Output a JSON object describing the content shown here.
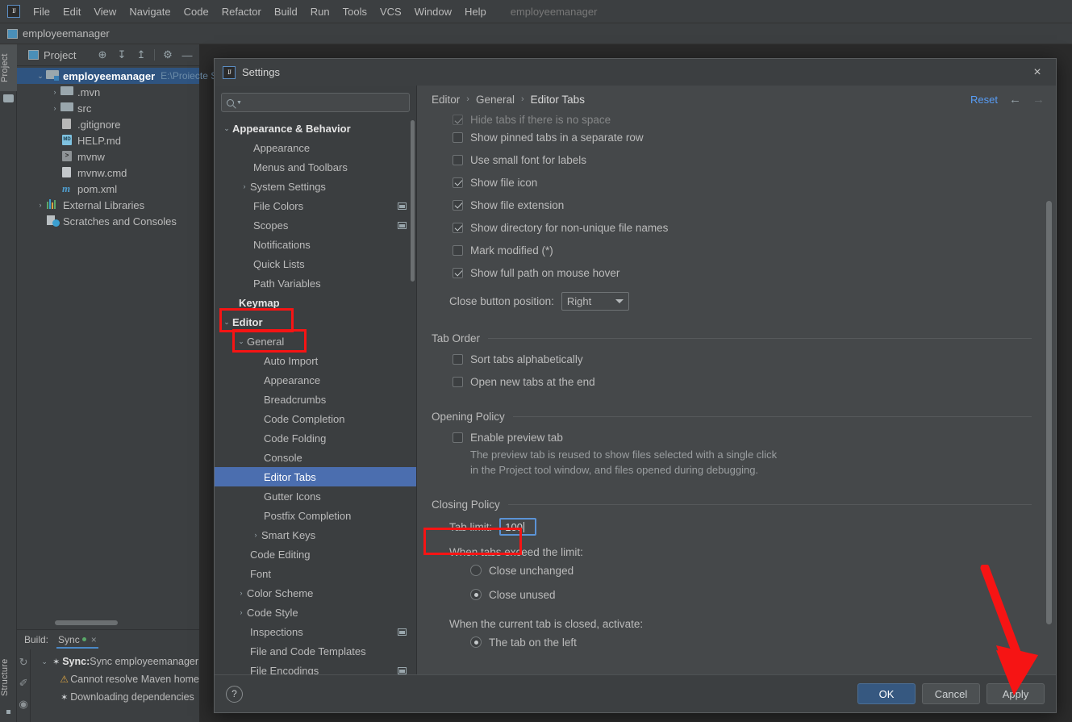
{
  "app": {
    "logo_text": "IJ",
    "project_name": "employeemanager",
    "menu": [
      "File",
      "Edit",
      "View",
      "Navigate",
      "Code",
      "Refactor",
      "Build",
      "Run",
      "Tools",
      "VCS",
      "Window",
      "Help"
    ],
    "navbar_item": "employeemanager"
  },
  "left_strip": {
    "project_tab": "Project",
    "structure_tab": "Structure"
  },
  "project_panel": {
    "title": "Project",
    "tools": [
      {
        "name": "locate-icon",
        "glyph": "⊕"
      },
      {
        "name": "expand-all-icon",
        "glyph": "↧"
      },
      {
        "name": "collapse-all-icon",
        "glyph": "↥"
      },
      {
        "name": "settings-gear-icon",
        "glyph": "⚙"
      },
      {
        "name": "hide-icon",
        "glyph": "—"
      }
    ],
    "tree": [
      {
        "label": "employeemanager",
        "path": "E:\\Proiecte SS",
        "arrow": "⌄",
        "indent": 0,
        "icon": "module-folder",
        "bold": true,
        "selected": true
      },
      {
        "label": ".mvn",
        "path": "",
        "arrow": "›",
        "indent": 1,
        "icon": "folder",
        "bold": false,
        "selected": false
      },
      {
        "label": "src",
        "path": "",
        "arrow": "›",
        "indent": 1,
        "icon": "folder",
        "bold": false,
        "selected": false
      },
      {
        "label": ".gitignore",
        "path": "",
        "arrow": "",
        "indent": 1,
        "icon": "git",
        "bold": false,
        "selected": false
      },
      {
        "label": "HELP.md",
        "path": "",
        "arrow": "",
        "indent": 1,
        "icon": "md",
        "bold": false,
        "selected": false
      },
      {
        "label": "mvnw",
        "path": "",
        "arrow": "",
        "indent": 1,
        "icon": "shell",
        "bold": false,
        "selected": false
      },
      {
        "label": "mvnw.cmd",
        "path": "",
        "arrow": "",
        "indent": 1,
        "icon": "file",
        "bold": false,
        "selected": false
      },
      {
        "label": "pom.xml",
        "path": "",
        "arrow": "",
        "indent": 1,
        "icon": "maven",
        "bold": false,
        "selected": false
      },
      {
        "label": "External Libraries",
        "path": "",
        "arrow": "›",
        "indent": 0,
        "icon": "library",
        "bold": false,
        "selected": false
      },
      {
        "label": "Scratches and Consoles",
        "path": "",
        "arrow": "",
        "indent": 0,
        "icon": "scratch",
        "bold": false,
        "selected": false
      }
    ]
  },
  "build_panel": {
    "label": "Build:",
    "tab": "Sync",
    "close_glyph": "×",
    "gutter": [
      {
        "name": "rerun-icon",
        "glyph": "↻"
      },
      {
        "name": "pin-icon",
        "glyph": "✐"
      },
      {
        "name": "eye-icon",
        "glyph": "◉"
      }
    ],
    "rows": [
      {
        "arrow": "⌄",
        "icon": "spinner",
        "bold_prefix": "Sync:",
        "text": " Sync employeemanager",
        "indent": 0
      },
      {
        "arrow": "",
        "icon": "warning",
        "bold_prefix": "",
        "text": "Cannot resolve Maven home",
        "indent": 1
      },
      {
        "arrow": "",
        "icon": "spinner",
        "bold_prefix": "",
        "text": "Downloading dependencies",
        "indent": 1
      }
    ]
  },
  "dialog": {
    "title": "Settings",
    "close_glyph": "×",
    "search": {
      "value": "",
      "placeholder": ""
    },
    "nav_items": [
      {
        "label": "Appearance & Behavior",
        "arrow": "⌄",
        "indent": 0,
        "bold": true,
        "badge": false,
        "selected": false
      },
      {
        "label": "Appearance",
        "arrow": "",
        "indent": 1,
        "bold": false,
        "badge": false,
        "selected": false
      },
      {
        "label": "Menus and Toolbars",
        "arrow": "",
        "indent": 1,
        "bold": false,
        "badge": false,
        "selected": false
      },
      {
        "label": "System Settings",
        "arrow": "›",
        "indent": 1,
        "bold": false,
        "badge": false,
        "selected": false
      },
      {
        "label": "File Colors",
        "arrow": "",
        "indent": 1,
        "bold": false,
        "badge": true,
        "selected": false
      },
      {
        "label": "Scopes",
        "arrow": "",
        "indent": 1,
        "bold": false,
        "badge": true,
        "selected": false
      },
      {
        "label": "Notifications",
        "arrow": "",
        "indent": 1,
        "bold": false,
        "badge": false,
        "selected": false
      },
      {
        "label": "Quick Lists",
        "arrow": "",
        "indent": 1,
        "bold": false,
        "badge": false,
        "selected": false
      },
      {
        "label": "Path Variables",
        "arrow": "",
        "indent": 1,
        "bold": false,
        "badge": false,
        "selected": false
      },
      {
        "label": "Keymap",
        "arrow": "",
        "indent": 0,
        "bold": true,
        "badge": false,
        "selected": false
      },
      {
        "label": "Editor",
        "arrow": "⌄",
        "indent": 0,
        "bold": true,
        "badge": false,
        "selected": false
      },
      {
        "label": "General",
        "arrow": "⌄",
        "indent": 1,
        "bold": false,
        "badge": false,
        "selected": false
      },
      {
        "label": "Auto Import",
        "arrow": "",
        "indent": 2,
        "bold": false,
        "badge": false,
        "selected": false
      },
      {
        "label": "Appearance",
        "arrow": "",
        "indent": 2,
        "bold": false,
        "badge": false,
        "selected": false
      },
      {
        "label": "Breadcrumbs",
        "arrow": "",
        "indent": 2,
        "bold": false,
        "badge": false,
        "selected": false
      },
      {
        "label": "Code Completion",
        "arrow": "",
        "indent": 2,
        "bold": false,
        "badge": false,
        "selected": false
      },
      {
        "label": "Code Folding",
        "arrow": "",
        "indent": 2,
        "bold": false,
        "badge": false,
        "selected": false
      },
      {
        "label": "Console",
        "arrow": "",
        "indent": 2,
        "bold": false,
        "badge": false,
        "selected": false
      },
      {
        "label": "Editor Tabs",
        "arrow": "",
        "indent": 2,
        "bold": false,
        "badge": false,
        "selected": true
      },
      {
        "label": "Gutter Icons",
        "arrow": "",
        "indent": 2,
        "bold": false,
        "badge": false,
        "selected": false
      },
      {
        "label": "Postfix Completion",
        "arrow": "",
        "indent": 2,
        "bold": false,
        "badge": false,
        "selected": false
      },
      {
        "label": "Smart Keys",
        "arrow": "›",
        "indent": 2,
        "bold": false,
        "badge": false,
        "selected": false
      },
      {
        "label": "Code Editing",
        "arrow": "",
        "indent": 1,
        "bold": false,
        "badge": false,
        "selected": false
      },
      {
        "label": "Font",
        "arrow": "",
        "indent": 1,
        "bold": false,
        "badge": false,
        "selected": false
      },
      {
        "label": "Color Scheme",
        "arrow": "›",
        "indent": 1,
        "bold": false,
        "badge": false,
        "selected": false
      },
      {
        "label": "Code Style",
        "arrow": "›",
        "indent": 1,
        "bold": false,
        "badge": false,
        "selected": false
      },
      {
        "label": "Inspections",
        "arrow": "",
        "indent": 1,
        "bold": false,
        "badge": true,
        "selected": false
      },
      {
        "label": "File and Code Templates",
        "arrow": "",
        "indent": 1,
        "bold": false,
        "badge": false,
        "selected": false
      },
      {
        "label": "File Encodings",
        "arrow": "",
        "indent": 1,
        "bold": false,
        "badge": true,
        "selected": false
      }
    ],
    "breadcrumb": {
      "items": [
        "Editor",
        "General",
        "Editor Tabs"
      ],
      "separator": "›",
      "reset_label": "Reset",
      "back_glyph": "←",
      "forward_glyph": "→"
    },
    "content": {
      "clipped_row": {
        "label": "Hide tabs if there is no space",
        "checked": true
      },
      "appearance_checkboxes": [
        {
          "label": "Show pinned tabs in a separate row",
          "checked": false
        },
        {
          "label": "Use small font for labels",
          "checked": false
        },
        {
          "label": "Show file icon",
          "checked": true
        },
        {
          "label": "Show file extension",
          "checked": true
        },
        {
          "label": "Show directory for non-unique file names",
          "checked": true
        },
        {
          "label": "Mark modified (*)",
          "checked": false
        },
        {
          "label": "Show full path on mouse hover",
          "checked": true
        }
      ],
      "close_button_position": {
        "label": "Close button position:",
        "value": "Right"
      },
      "tab_order": {
        "title": "Tab Order",
        "checkboxes": [
          {
            "label": "Sort tabs alphabetically",
            "checked": false
          },
          {
            "label": "Open new tabs at the end",
            "checked": false
          }
        ]
      },
      "opening_policy": {
        "title": "Opening Policy",
        "checkbox": {
          "label": "Enable preview tab",
          "checked": false
        },
        "description_line1": "The preview tab is reused to show files selected with a single click",
        "description_line2": "in the Project tool window, and files opened during debugging."
      },
      "closing_policy": {
        "title": "Closing Policy",
        "tab_limit_label": "Tab limit:",
        "tab_limit_value": "100",
        "exceed_label": "When tabs exceed the limit:",
        "exceed_options": [
          {
            "label": "Close unchanged",
            "selected": false
          },
          {
            "label": "Close unused",
            "selected": true
          }
        ],
        "activate_label": "When the current tab is closed, activate:",
        "activate_options": [
          {
            "label": "The tab on the left",
            "selected": true
          }
        ]
      }
    },
    "footer": {
      "help_glyph": "?",
      "ok_label": "OK",
      "cancel_label": "Cancel",
      "apply_label": "Apply"
    }
  },
  "annotations": {
    "highlight_color": "#f61414",
    "boxes": [
      "Editor",
      "General",
      "Tab limit"
    ],
    "arrow_target": "Apply"
  }
}
